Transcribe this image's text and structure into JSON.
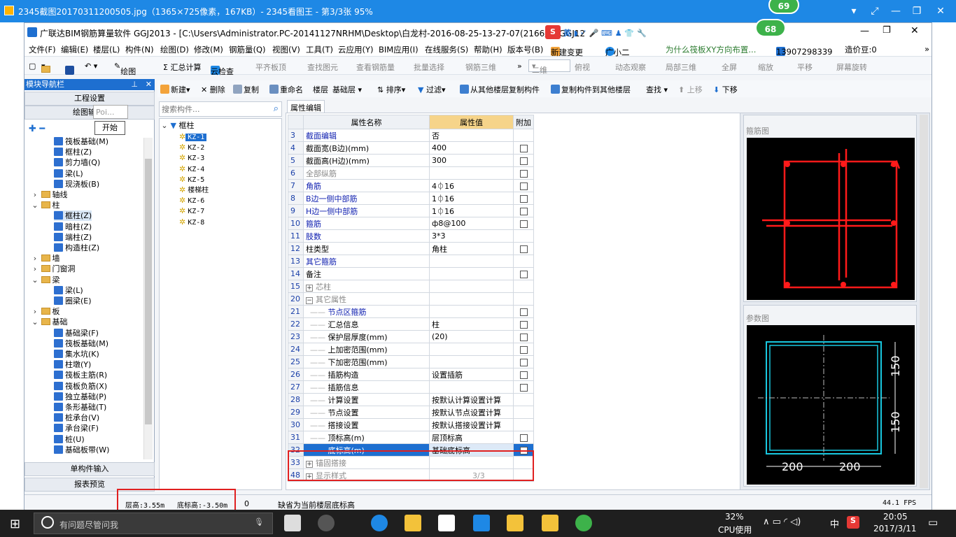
{
  "viewer": {
    "title": "2345截图20170311200505.jpg（1365×725像素，167KB）- 2345看图王 - 第3/3张 95%",
    "badge1": "69",
    "badge2": "68"
  },
  "app": {
    "title": "广联达BIM钢筋算量软件 GGJ2013 - [C:\\Users\\Administrator.PC-20141127NRHM\\Desktop\\白龙村-2016-08-25-13-27-07(2166版).GGJ12"
  },
  "menu": [
    "文件(F)",
    "编辑(E)",
    "楼层(L)",
    "构件(N)",
    "绘图(D)",
    "修改(M)",
    "钢筋量(Q)",
    "视图(V)",
    "工具(T)",
    "云应用(Y)",
    "BIM应用(I)",
    "在线服务(S)",
    "帮助(H)",
    "版本号(B)",
    "新建变更",
    "广小二",
    "为什么筏板XY方向布置...",
    "13907298339",
    "造价豆:0"
  ],
  "toolbar1": [
    "绘图",
    "Σ 汇总计算",
    "云检查",
    "平齐板顶",
    "查找图元",
    "查看钢筋量",
    "批量选择",
    "钢筋三维",
    "二维",
    "俯视",
    "动态观察",
    "局部三维",
    "全屏",
    "缩放",
    "平移",
    "屏幕旋转"
  ],
  "toolbar2": [
    "新建",
    "删除",
    "复制",
    "重命名",
    "楼层",
    "基础层",
    "排序",
    "过滤",
    "从其他楼层复制构件",
    "复制构件到其他楼层",
    "查找",
    "上移",
    "下移"
  ],
  "nav": {
    "header": "模块导航栏",
    "engineering": "工程设置",
    "drawing": "绘图输",
    "popup_poi": "Poi...",
    "popup_start": "开始",
    "single_input": "单构件输入",
    "report": "报表预览",
    "items": [
      {
        "label": "筏板基础(M)",
        "type": "leaf",
        "indent": 2
      },
      {
        "label": "框柱(Z)",
        "type": "leaf",
        "indent": 2
      },
      {
        "label": "剪力墙(Q)",
        "type": "leaf",
        "indent": 2
      },
      {
        "label": "梁(L)",
        "type": "leaf",
        "indent": 2
      },
      {
        "label": "现浇板(B)",
        "type": "leaf",
        "indent": 2
      },
      {
        "label": "轴线",
        "type": "folder",
        "indent": 0,
        "tog": "›"
      },
      {
        "label": "柱",
        "type": "folder",
        "indent": 0,
        "tog": "⌄"
      },
      {
        "label": "框柱(Z)",
        "type": "leaf",
        "indent": 2,
        "sel": true
      },
      {
        "label": "暗柱(Z)",
        "type": "leaf",
        "indent": 2
      },
      {
        "label": "端柱(Z)",
        "type": "leaf",
        "indent": 2
      },
      {
        "label": "构造柱(Z)",
        "type": "leaf",
        "indent": 2
      },
      {
        "label": "墙",
        "type": "folder",
        "indent": 0,
        "tog": "›"
      },
      {
        "label": "门窗洞",
        "type": "folder",
        "indent": 0,
        "tog": "›"
      },
      {
        "label": "梁",
        "type": "folder",
        "indent": 0,
        "tog": "⌄"
      },
      {
        "label": "梁(L)",
        "type": "leaf",
        "indent": 2
      },
      {
        "label": "圈梁(E)",
        "type": "leaf",
        "indent": 2
      },
      {
        "label": "板",
        "type": "folder",
        "indent": 0,
        "tog": "›"
      },
      {
        "label": "基础",
        "type": "folder",
        "indent": 0,
        "tog": "⌄"
      },
      {
        "label": "基础梁(F)",
        "type": "leaf",
        "indent": 2
      },
      {
        "label": "筏板基础(M)",
        "type": "leaf",
        "indent": 2
      },
      {
        "label": "集水坑(K)",
        "type": "leaf",
        "indent": 2
      },
      {
        "label": "柱墩(Y)",
        "type": "leaf",
        "indent": 2
      },
      {
        "label": "筏板主筋(R)",
        "type": "leaf",
        "indent": 2
      },
      {
        "label": "筏板负筋(X)",
        "type": "leaf",
        "indent": 2
      },
      {
        "label": "独立基础(P)",
        "type": "leaf",
        "indent": 2
      },
      {
        "label": "条形基础(T)",
        "type": "leaf",
        "indent": 2
      },
      {
        "label": "桩承台(V)",
        "type": "leaf",
        "indent": 2
      },
      {
        "label": "承台梁(F)",
        "type": "leaf",
        "indent": 2
      },
      {
        "label": "桩(U)",
        "type": "leaf",
        "indent": 2
      },
      {
        "label": "基础板带(W)",
        "type": "leaf",
        "indent": 2
      }
    ]
  },
  "components": {
    "search_placeholder": "搜索构件...",
    "root": "框柱",
    "items": [
      "KZ-1",
      "KZ-2",
      "KZ-3",
      "KZ-4",
      "KZ-5",
      "楼梯柱",
      "KZ-6",
      "KZ-7",
      "KZ-8"
    ]
  },
  "props": {
    "tab": "属性编辑",
    "col_name": "属性名称",
    "col_value": "属性值",
    "col_extra": "附加",
    "rows": [
      {
        "n": "3",
        "name": "截面编辑",
        "value": "否",
        "blue": true,
        "cb": false
      },
      {
        "n": "4",
        "name": "截面宽(B边)(mm)",
        "value": "400",
        "cb": true
      },
      {
        "n": "5",
        "name": "截面高(H边)(mm)",
        "value": "300",
        "cb": true
      },
      {
        "n": "6",
        "name": "全部纵筋",
        "value": "",
        "grey": true,
        "cb": true
      },
      {
        "n": "7",
        "name": "角筋",
        "value": "4⏀16",
        "blue": true,
        "cb": true
      },
      {
        "n": "8",
        "name": "B边一侧中部筋",
        "value": "1⏀16",
        "blue": true,
        "cb": true
      },
      {
        "n": "9",
        "name": "H边一侧中部筋",
        "value": "1⏀16",
        "blue": true,
        "cb": true
      },
      {
        "n": "10",
        "name": "箍筋",
        "value": "ф8@100",
        "blue": true,
        "cb": true
      },
      {
        "n": "11",
        "name": "肢数",
        "value": "3*3",
        "blue": true,
        "cb": false
      },
      {
        "n": "12",
        "name": "柱类型",
        "value": "角柱",
        "cb": true
      },
      {
        "n": "13",
        "name": "其它箍筋",
        "value": "",
        "blue": true,
        "cb": false
      },
      {
        "n": "14",
        "name": "备注",
        "value": "",
        "cb": true
      },
      {
        "n": "15",
        "name": "芯柱",
        "value": "",
        "grey": true,
        "expand": "+",
        "cb": false
      },
      {
        "n": "20",
        "name": "其它属性",
        "value": "",
        "grey": true,
        "expand": "−",
        "cb": false
      },
      {
        "n": "21",
        "name": "节点区箍筋",
        "value": "",
        "blue": true,
        "sub": true,
        "cb": true
      },
      {
        "n": "22",
        "name": "汇总信息",
        "value": "柱",
        "sub": true,
        "cb": true
      },
      {
        "n": "23",
        "name": "保护层厚度(mm)",
        "value": "(20)",
        "sub": true,
        "cb": true
      },
      {
        "n": "24",
        "name": "上加密范围(mm)",
        "value": "",
        "sub": true,
        "cb": true
      },
      {
        "n": "25",
        "name": "下加密范围(mm)",
        "value": "",
        "sub": true,
        "cb": true
      },
      {
        "n": "26",
        "name": "插筋构造",
        "value": "设置插筋",
        "sub": true,
        "cb": true
      },
      {
        "n": "27",
        "name": "插筋信息",
        "value": "",
        "sub": true,
        "cb": true
      },
      {
        "n": "28",
        "name": "计算设置",
        "value": "按默认计算设置计算",
        "sub": true,
        "cb": false
      },
      {
        "n": "29",
        "name": "节点设置",
        "value": "按默认节点设置计算",
        "sub": true,
        "cb": false
      },
      {
        "n": "30",
        "name": "搭接设置",
        "value": "按默认搭接设置计算",
        "sub": true,
        "cb": false
      },
      {
        "n": "31",
        "name": "顶标高(m)",
        "value": "层顶标高",
        "sub": true,
        "cb": true
      },
      {
        "n": "32",
        "name": "底标高(m)",
        "value": "基础底标高",
        "sub": true,
        "cb": true,
        "hl": true
      },
      {
        "n": "33",
        "name": "锚固搭接",
        "value": "",
        "grey": true,
        "expand": "+",
        "cb": false
      },
      {
        "n": "48",
        "name": "显示样式",
        "value": "",
        "grey": true,
        "expand": "+",
        "cb": false
      }
    ]
  },
  "previews": {
    "stirrup": "箍筋图",
    "param": "参数图",
    "dim150a": "150",
    "dim150b": "150",
    "dim200a": "200",
    "dim200b": "200"
  },
  "status": {
    "floor_height": "层高:3.55m",
    "bottom_elev": "底标高:-3.50m",
    "zero": "0",
    "message": "缺省为当前楼层底标高",
    "page": "3/3",
    "fps": "44.1 FPS"
  },
  "taskbar": {
    "search": "有问题尽管问我",
    "cpu_pct": "32%",
    "cpu_label": "CPU使用",
    "ime": "中",
    "time": "20:05",
    "date": "2017/3/11"
  }
}
